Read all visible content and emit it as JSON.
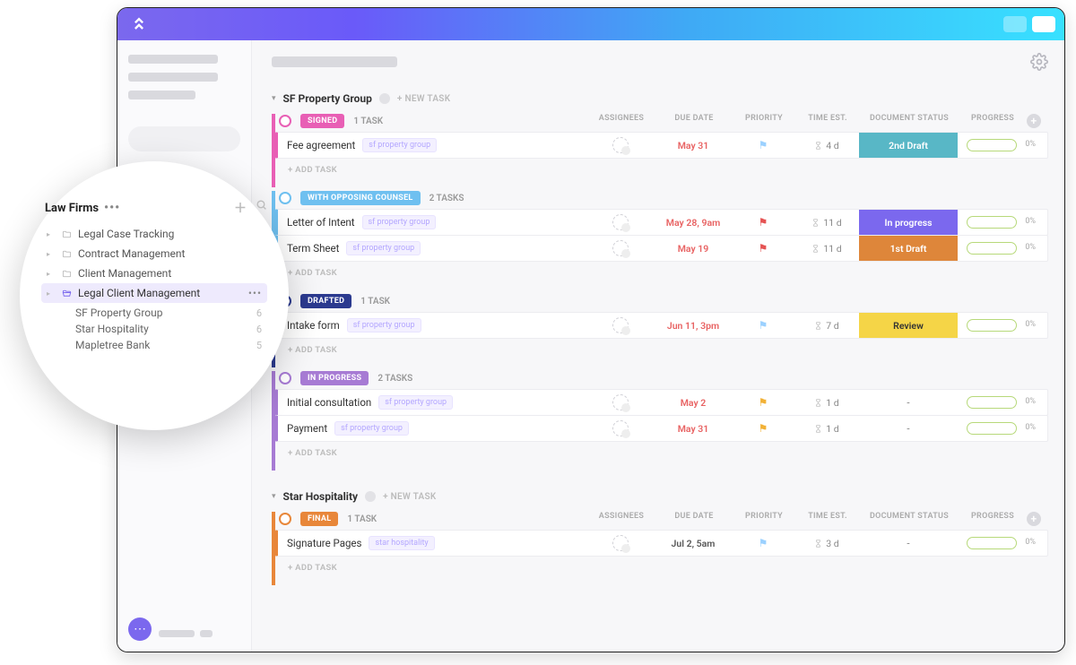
{
  "sidebar_overlay": {
    "title": "Law Firms",
    "items": [
      {
        "label": "Legal Case Tracking",
        "icon": "folder"
      },
      {
        "label": "Contract Management",
        "icon": "folder"
      },
      {
        "label": "Client Management",
        "icon": "folder"
      },
      {
        "label": "Legal Client Management",
        "icon": "folder-open",
        "active": true
      },
      {
        "label": "SF Property Group",
        "count": "6",
        "sub": true
      },
      {
        "label": "Star Hospitality",
        "count": "6",
        "sub": true
      },
      {
        "label": "Mapletree Bank",
        "count": "5",
        "sub": true
      }
    ]
  },
  "columns": {
    "assignees": "ASSIGNEES",
    "due": "DUE DATE",
    "priority": "PRIORITY",
    "time": "TIME EST.",
    "doc": "DOCUMENT STATUS",
    "progress": "PROGRESS"
  },
  "labels": {
    "new_task": "+ NEW TASK",
    "add_task": "+ ADD TASK"
  },
  "lists": [
    {
      "name": "SF Property Group",
      "tag": "sf property group",
      "groups": [
        {
          "status": "SIGNED",
          "color": "#e85fb5",
          "count": "1 TASK",
          "show_headers": true,
          "tasks": [
            {
              "name": "Fee agreement",
              "due": "May 31",
              "due_cls": "due-red",
              "prio_color": "#9bd1ff",
              "time": "4 d",
              "doc": "2nd Draft",
              "doc_bg": "#58b7c6",
              "progress": "0%"
            }
          ]
        },
        {
          "status": "WITH OPPOSING COUNSEL",
          "color": "#6fc0f0",
          "count": "2 TASKS",
          "tasks": [
            {
              "name": "Letter of Intent",
              "due": "May 28, 9am",
              "due_cls": "due-red",
              "prio_color": "#e55353",
              "time": "11 d",
              "doc": "In progress",
              "doc_bg": "#7b68ee",
              "progress": "0%"
            },
            {
              "name": "Term Sheet",
              "due": "May 19",
              "due_cls": "due-red",
              "prio_color": "#e55353",
              "time": "11 d",
              "doc": "1st Draft",
              "doc_bg": "#de863a",
              "progress": "0%"
            }
          ]
        },
        {
          "status": "DRAFTED",
          "color": "#2b3a8f",
          "count": "1 TASK",
          "tasks": [
            {
              "name": "Intake form",
              "due": "Jun 11, 3pm",
              "due_cls": "due-red",
              "prio_color": "#9bd1ff",
              "time": "7 d",
              "doc": "Review",
              "doc_bg": "#f5d547",
              "doc_fg": "#333",
              "progress": "0%"
            }
          ]
        },
        {
          "status": "IN PROGRESS",
          "color": "#a77bd4",
          "count": "2 TASKS",
          "tasks": [
            {
              "name": "Initial consultation",
              "due": "May 2",
              "due_cls": "due-red",
              "prio_color": "#f2b136",
              "time": "1 d",
              "doc": "-",
              "progress": "0%"
            },
            {
              "name": "Payment",
              "due": "May 31",
              "due_cls": "due-red",
              "prio_color": "#f2b136",
              "time": "1 d",
              "doc": "-",
              "progress": "0%"
            }
          ]
        }
      ]
    },
    {
      "name": "Star Hospitality",
      "tag": "star hospitality",
      "groups": [
        {
          "status": "FINAL",
          "color": "#e8873a",
          "count": "1 TASK",
          "show_headers": true,
          "tasks": [
            {
              "name": "Signature Pages",
              "due": "Jul 2, 5am",
              "due_cls": "due-dark",
              "prio_color": "#9bd1ff",
              "time": "3 d",
              "doc": "-",
              "progress": "0%"
            }
          ]
        }
      ]
    }
  ]
}
